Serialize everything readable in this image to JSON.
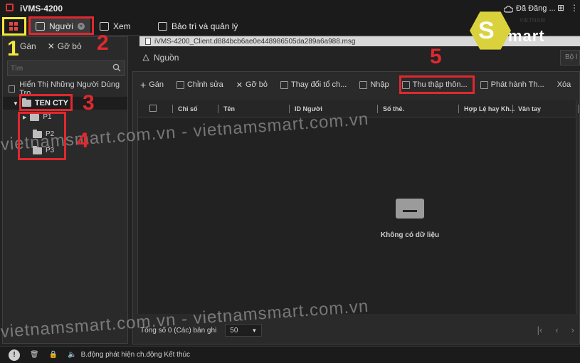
{
  "app": {
    "title": "iVMS-4200",
    "login_status": "Đã Đăng ..."
  },
  "tabs": [
    {
      "label": "Người"
    },
    {
      "label": "Xem"
    },
    {
      "label": "Bảo trì và quản lý"
    }
  ],
  "file_bar": {
    "filename": "iVMS-4200_Client.d884bcb6ae0e448986505da289a6a988.msg"
  },
  "left_panel": {
    "assign_label": "Gán",
    "remove_label": "Gỡ bỏ",
    "search_placeholder": "Tìm",
    "show_sub_label": "Hiển Thị Những Người Dùng Tro...",
    "org_name": "TEN CTY",
    "children": [
      "P1",
      "P2",
      "P3"
    ]
  },
  "breadcrumb": {
    "label": "Nguồn"
  },
  "top_right_search": {
    "placeholder": "Bộ l"
  },
  "toolbar": {
    "add": "Gán",
    "edit": "Chỉnh sửa",
    "remove": "Gỡ bỏ",
    "change_org": "Thay đổi tổ ch...",
    "import": "Nhập",
    "collect": "Thu thập thôn...",
    "issue": "Phát hành Th...",
    "delete": "Xóa"
  },
  "table": {
    "columns": [
      "Chỉ số",
      "Tên",
      "ID Người",
      "Số thẻ.",
      "Hợp Lệ hay Kh...",
      "Vân tay"
    ],
    "empty_text": "Không có dữ liệu"
  },
  "footer": {
    "total": "Tổng số 0 (Các) bản ghi",
    "page_size": "50"
  },
  "statusbar": {
    "message": "B.động phát hiện ch.động Kết thúc"
  },
  "annotations": [
    "1",
    "2",
    "3",
    "4",
    "5"
  ],
  "watermark": {
    "text": "vietnamsmart.com.vn - vietnamsmart.com.vn"
  },
  "brand": {
    "small": "VIETNAM",
    "logo_letter": "S",
    "text": "mart"
  },
  "colors": {
    "annotation_red": "#e0282f",
    "annotation_yellow": "#f2e93a",
    "brand_yellow": "#d9d23d",
    "home_icon": "#e04848"
  }
}
